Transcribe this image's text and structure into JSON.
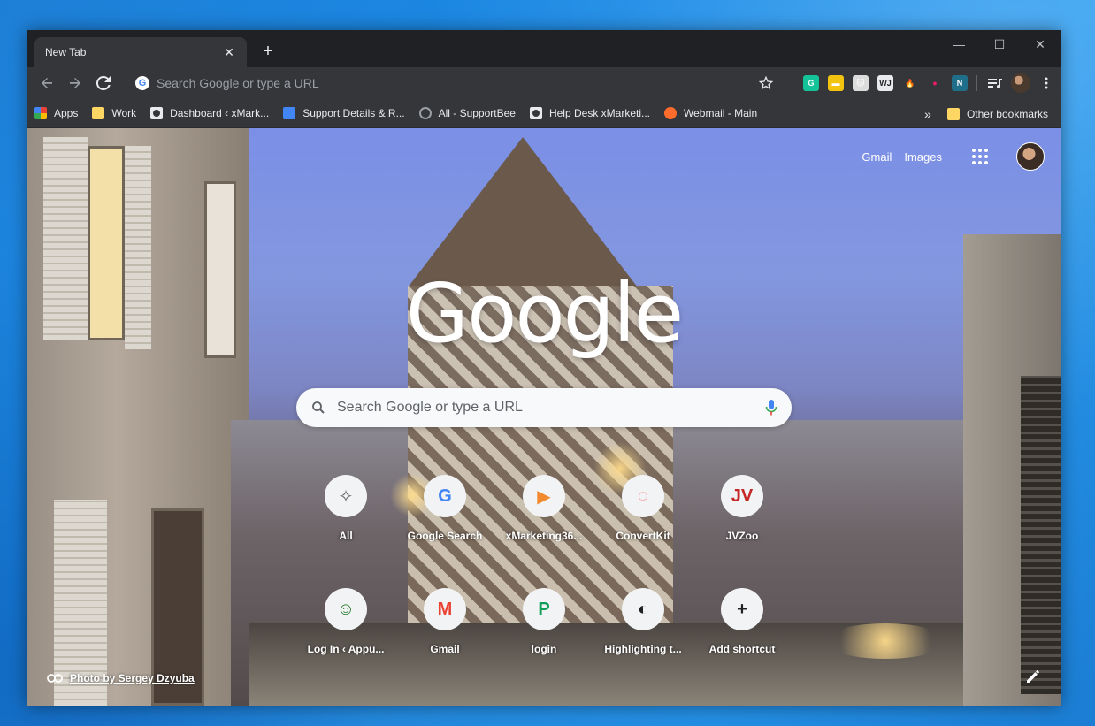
{
  "tab": {
    "title": "New Tab",
    "close": "✕",
    "new": "+"
  },
  "window_controls": {
    "minimize": "—",
    "maximize": "☐",
    "close": "✕"
  },
  "omnibox": {
    "placeholder": "Search Google or type a URL"
  },
  "extensions": [
    {
      "name": "grammarly-icon",
      "label": "G",
      "color": "#15c39a"
    },
    {
      "name": "notes-extension-icon",
      "label": "▬",
      "color": "#f2c40f"
    },
    {
      "name": "cat-extension-icon",
      "label": "🐱",
      "color": "#dcdcdc"
    },
    {
      "name": "wj-extension-icon",
      "label": "WJ",
      "color": "#e8eaed"
    },
    {
      "name": "fire-extension-icon",
      "label": "🔥",
      "color": "#35363a"
    },
    {
      "name": "color-wheel-extension-icon",
      "label": "●",
      "color": "#35363a"
    },
    {
      "name": "n-extension-icon",
      "label": "N",
      "color": "#1f6f8b"
    }
  ],
  "bookmarks": [
    {
      "label": "Apps",
      "icon": "apps-grid-icon"
    },
    {
      "label": "Work",
      "icon": "folder-icon"
    },
    {
      "label": "Dashboard ‹ xMark...",
      "icon": "globe-icon"
    },
    {
      "label": "Support Details & R...",
      "icon": "docs-icon"
    },
    {
      "label": "All - SupportBee",
      "icon": "supportbee-icon"
    },
    {
      "label": "Help Desk xMarketi...",
      "icon": "globe-icon"
    },
    {
      "label": "Webmail - Main",
      "icon": "cpanel-icon"
    }
  ],
  "bookmarks_overflow": "»",
  "other_bookmarks": "Other bookmarks",
  "ntp": {
    "gmail": "Gmail",
    "images": "Images",
    "logo": "Google",
    "search_placeholder": "Search Google or type a URL",
    "attribution": "Photo by Sergey Dzyuba"
  },
  "tiles_row1": [
    {
      "label": "All",
      "glyph": "✧",
      "color": "#5f6368"
    },
    {
      "label": "Google Search",
      "glyph": "G",
      "color": "#4285f4"
    },
    {
      "label": "xMarketing36...",
      "glyph": "▶",
      "color": "#f28b30"
    },
    {
      "label": "ConvertKit",
      "glyph": "◌",
      "color": "#fb6970"
    },
    {
      "label": "JVZoo",
      "glyph": "JV",
      "color": "#c62828"
    }
  ],
  "tiles_row2": [
    {
      "label": "Log In ‹ Appu...",
      "glyph": "☺",
      "color": "#2e7d32"
    },
    {
      "label": "Gmail",
      "glyph": "M",
      "color": "#ea4335"
    },
    {
      "label": "login",
      "glyph": "P",
      "color": "#0f9d58"
    },
    {
      "label": "Highlighting t...",
      "glyph": "◐",
      "color": "#202124"
    },
    {
      "label": "Add shortcut",
      "glyph": "+",
      "color": "#202124"
    }
  ]
}
